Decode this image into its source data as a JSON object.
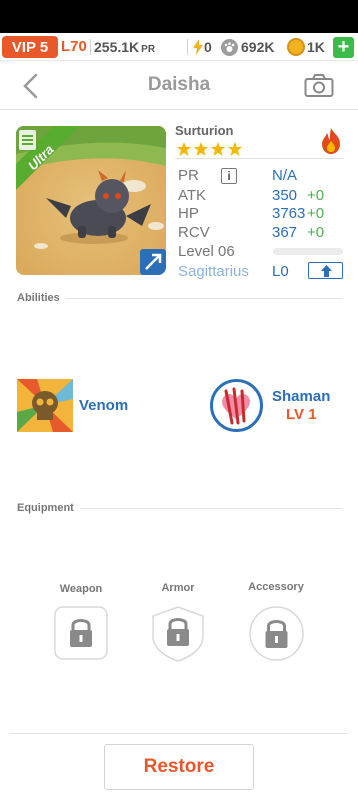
{
  "topbar": {
    "vip": "VIP 5",
    "level": "L70",
    "power": "255.1K",
    "power_unit": "PR",
    "energy": "0",
    "food": "692K",
    "coins": "1K",
    "plus": "+"
  },
  "header": {
    "title": "Daisha"
  },
  "pet": {
    "rarity": "Ultra",
    "species": "Surturion",
    "stars": 4,
    "element": "fire",
    "stats": {
      "pr_label": "PR",
      "pr_info": "i",
      "pr_value": "N/A",
      "atk_label": "ATK",
      "atk_value": "350",
      "atk_bonus": "+0",
      "hp_label": "HP",
      "hp_value": "3763",
      "hp_bonus": "+0",
      "rcv_label": "RCV",
      "rcv_value": "367",
      "rcv_bonus": "+0",
      "level_label": "Level 06",
      "level_progress": 0,
      "zodiac": "Sagittarius",
      "zodiac_level": "L0"
    }
  },
  "abilities": {
    "title": "Abilities",
    "items": [
      {
        "name": "Venom",
        "icon": "skull-icon"
      },
      {
        "name": "Shaman",
        "level": "LV 1",
        "icon": "heart-claw-icon"
      }
    ]
  },
  "equipment": {
    "title": "Equipment",
    "slots": [
      {
        "label": "Weapon",
        "icon": "lock-icon"
      },
      {
        "label": "Armor",
        "icon": "lock-icon"
      },
      {
        "label": "Accessory",
        "icon": "lock-icon"
      }
    ]
  },
  "footer": {
    "restore": "Restore"
  },
  "colors": {
    "accent": "#e8582a",
    "blue": "#2a6fb8",
    "green": "#4caf50",
    "star": "#f5b800"
  }
}
